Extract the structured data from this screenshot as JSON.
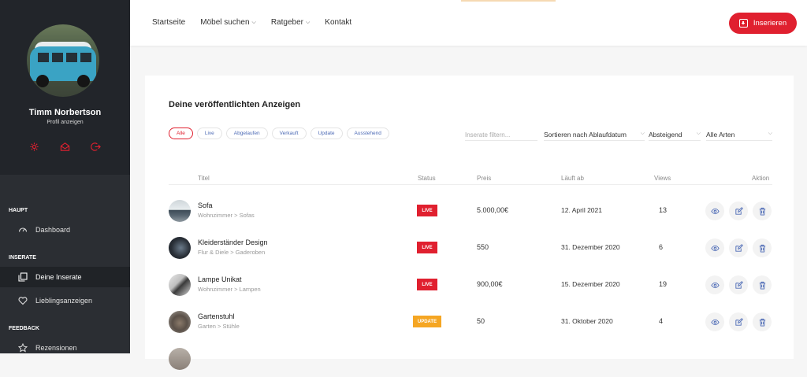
{
  "sidebar": {
    "profile": {
      "name": "Timm Norbertson",
      "link": "Profil anzeigen",
      "icons": [
        "settings-icon",
        "inbox-icon",
        "logout-icon"
      ]
    },
    "sections": [
      {
        "label": "HAUPT",
        "items": [
          {
            "label": "Dashboard",
            "icon": "dashboard-icon"
          }
        ]
      },
      {
        "label": "INSERATE",
        "items": [
          {
            "label": "Deine Inserate",
            "icon": "copy-icon",
            "active": true
          },
          {
            "label": "Lieblingsanzeigen",
            "icon": "heart-icon"
          }
        ]
      },
      {
        "label": "FEEDBACK",
        "items": [
          {
            "label": "Rezensionen",
            "icon": "star-icon"
          }
        ]
      }
    ]
  },
  "topnav": {
    "items": [
      {
        "label": "Startseite"
      },
      {
        "label": "Möbel suchen",
        "dropdown": true
      },
      {
        "label": "Ratgeber",
        "dropdown": true
      },
      {
        "label": "Kontakt"
      }
    ],
    "insert_label": "Inserieren"
  },
  "main": {
    "title": "Deine veröffentlichten Anzeigen",
    "filters": [
      "Alle",
      "Live",
      "Abgelaufen",
      "Verkauft",
      "Update",
      "Ausstehend"
    ],
    "active_filter": "Alle",
    "search_placeholder": "Inserate filtern...",
    "sort_value": "Sortieren nach Ablaufdatum",
    "order_value": "Absteigend",
    "type_value": "Alle Arten",
    "columns": [
      "Titel",
      "Status",
      "Preis",
      "Läuft ab",
      "Views",
      "Aktion"
    ],
    "rows": [
      {
        "title": "Sofa",
        "category": "Wohnzimmer > Sofas",
        "status": "LIVE",
        "price": "5.000,00€",
        "expires": "12. April 2021",
        "views": "13"
      },
      {
        "title": "Kleiderständer Design",
        "category": "Flur & Diele > Gaderoben",
        "status": "LIVE",
        "price": "550",
        "expires": "31. Dezember 2020",
        "views": "6"
      },
      {
        "title": "Lampe Unikat",
        "category": "Wohnzimmer > Lampen",
        "status": "LIVE",
        "price": "900,00€",
        "expires": "15. Dezember 2020",
        "views": "19"
      },
      {
        "title": "Gartenstuhl",
        "category": "Garten > Stühle",
        "status": "UPDATE",
        "price": "50",
        "expires": "31. Oktober 2020",
        "views": "4"
      }
    ],
    "row_actions": [
      "eye-icon",
      "edit-icon",
      "trash-icon"
    ]
  },
  "colors": {
    "accent": "#e0202f",
    "live": "#e0202f",
    "update": "#f5a623",
    "sidebar": "#2b2e33",
    "link": "#4c6ab5"
  }
}
